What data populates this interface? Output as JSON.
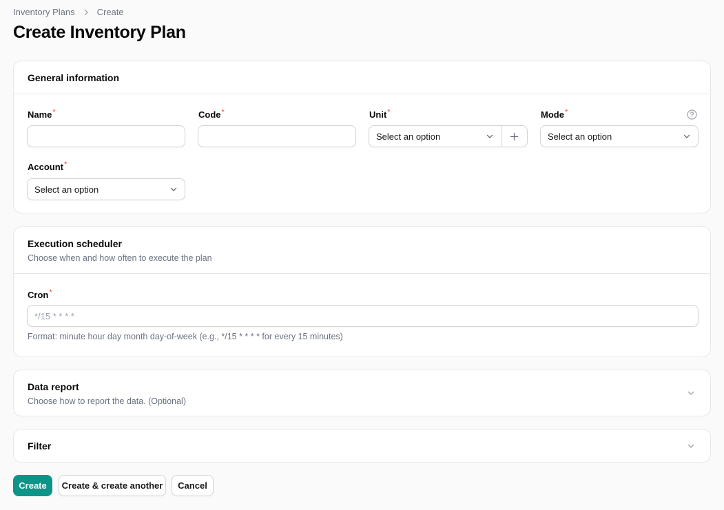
{
  "breadcrumb": {
    "items": [
      "Inventory Plans",
      "Create"
    ]
  },
  "page": {
    "title": "Create Inventory Plan"
  },
  "general": {
    "title": "General information",
    "name_label": "Name",
    "code_label": "Code",
    "unit_label": "Unit",
    "unit_value": "Select an option",
    "mode_label": "Mode",
    "mode_value": "Select an option",
    "account_label": "Account",
    "account_value": "Select an option",
    "required_mark": "*"
  },
  "scheduler": {
    "title": "Execution scheduler",
    "description": "Choose when and how often to execute the plan",
    "cron_label": "Cron",
    "cron_placeholder": "*/15 * * * *",
    "cron_hint": "Format: minute hour day month day-of-week (e.g., */15 * * * * for every 15 minutes)"
  },
  "data_report": {
    "title": "Data report",
    "description": "Choose how to report the data. (Optional)"
  },
  "filter": {
    "title": "Filter"
  },
  "actions": {
    "create": "Create",
    "create_another": "Create & create another",
    "cancel": "Cancel"
  },
  "colors": {
    "primary": "#0d9488",
    "required": "#ef4444"
  }
}
